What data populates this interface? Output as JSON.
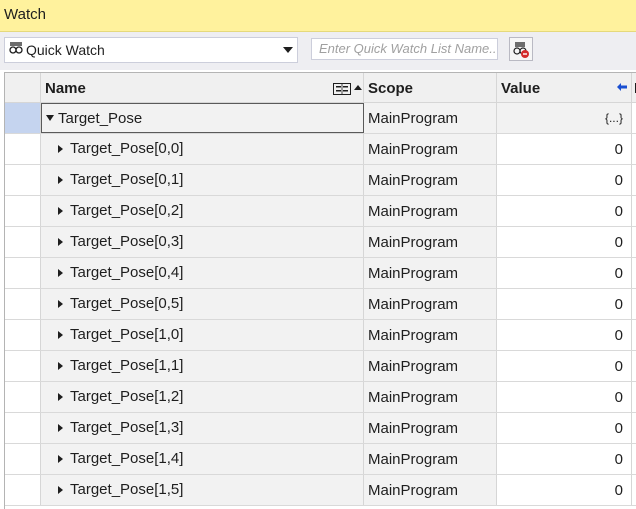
{
  "window": {
    "title": "Watch"
  },
  "toolbar": {
    "combo_value": "Quick Watch",
    "list_placeholder": "Enter Quick Watch List Name..."
  },
  "columns": {
    "name": "Name",
    "scope": "Scope",
    "value": "Value",
    "extra": "I"
  },
  "rows": [
    {
      "name": "Target_Pose",
      "scope": "MainProgram",
      "value": "{...}",
      "expanded": true
    },
    {
      "name": "Target_Pose[0,0]",
      "scope": "MainProgram",
      "value": "0"
    },
    {
      "name": "Target_Pose[0,1]",
      "scope": "MainProgram",
      "value": "0"
    },
    {
      "name": "Target_Pose[0,2]",
      "scope": "MainProgram",
      "value": "0"
    },
    {
      "name": "Target_Pose[0,3]",
      "scope": "MainProgram",
      "value": "0"
    },
    {
      "name": "Target_Pose[0,4]",
      "scope": "MainProgram",
      "value": "0"
    },
    {
      "name": "Target_Pose[0,5]",
      "scope": "MainProgram",
      "value": "0"
    },
    {
      "name": "Target_Pose[1,0]",
      "scope": "MainProgram",
      "value": "0"
    },
    {
      "name": "Target_Pose[1,1]",
      "scope": "MainProgram",
      "value": "0"
    },
    {
      "name": "Target_Pose[1,2]",
      "scope": "MainProgram",
      "value": "0"
    },
    {
      "name": "Target_Pose[1,3]",
      "scope": "MainProgram",
      "value": "0"
    },
    {
      "name": "Target_Pose[1,4]",
      "scope": "MainProgram",
      "value": "0"
    },
    {
      "name": "Target_Pose[1,5]",
      "scope": "MainProgram",
      "value": "0"
    }
  ],
  "colors": {
    "title_bg": "#fff29d",
    "selection": "#c5d4ef",
    "pin_arrow": "#1a4fd1"
  }
}
